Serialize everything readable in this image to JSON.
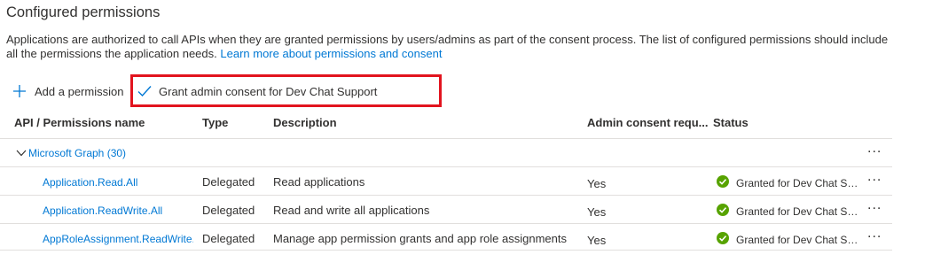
{
  "section": {
    "title": "Configured permissions",
    "description": "Applications are authorized to call APIs when they are granted permissions by users/admins as part of the consent process. The list of configured permissions should include all the permissions the application needs.",
    "learn_more": "Learn more about permissions and consent"
  },
  "toolbar": {
    "add_label": "Add a permission",
    "grant_label": "Grant admin consent for Dev Chat Support",
    "highlight_color": "#e2141e"
  },
  "table": {
    "headers": {
      "api": "API / Permissions name",
      "type": "Type",
      "description": "Description",
      "admin": "Admin consent requ...",
      "status": "Status"
    },
    "group": {
      "label": "Microsoft Graph (30)",
      "expanded": true
    },
    "rows": [
      {
        "name": "Application.Read.All",
        "type": "Delegated",
        "description": "Read applications",
        "admin": "Yes",
        "status": "Granted for Dev Chat Su..."
      },
      {
        "name": "Application.ReadWrite.All",
        "type": "Delegated",
        "description": "Read and write all applications",
        "admin": "Yes",
        "status": "Granted for Dev Chat Su..."
      },
      {
        "name": "AppRoleAssignment.ReadWrite.",
        "type": "Delegated",
        "description": "Manage app permission grants and app role assignments",
        "admin": "Yes",
        "status": "Granted for Dev Chat Su..."
      }
    ],
    "more_label": "...",
    "status_icon": "check-circle-icon",
    "status_color": "#57a300"
  },
  "colors": {
    "link": "#0078d4",
    "text": "#323130"
  }
}
